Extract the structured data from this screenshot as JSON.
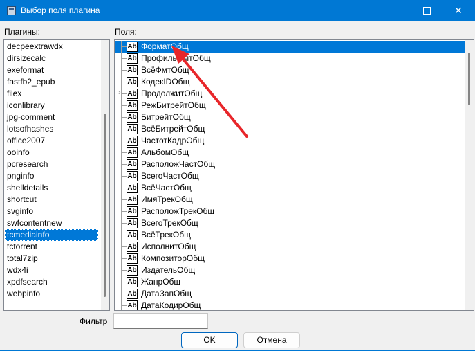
{
  "window": {
    "title": "Выбор поля плагина",
    "accent": "#0078d4",
    "icon": "floppy-disk-icon"
  },
  "labels": {
    "plugins": "Плагины:",
    "fields": "Поля:",
    "filter": "Фильтр"
  },
  "plugins": [
    "decpeextrawdx",
    "dirsizecalc",
    "exeformat",
    "fastfb2_epub",
    "filex",
    "iconlibrary",
    "jpg-comment",
    "lotsofhashes",
    "office2007",
    "ooinfo",
    "pcresearch",
    "pnginfo",
    "shelldetails",
    "shortcut",
    "svginfo",
    "swfcontentnew",
    "tcmediainfo",
    "tctorrent",
    "total7zip",
    "wdx4i",
    "xpdfsearch",
    "webpinfo"
  ],
  "selected_plugin": "tcmediainfo",
  "fields": [
    "ФорматОбщ",
    "ПрофильФмтОбщ",
    "ВсёФмтОбщ",
    "КодекIDОбщ",
    "ПродолжитОбщ",
    "РежБитрейтОбщ",
    "БитрейтОбщ",
    "ВсёБитрейтОбщ",
    "ЧастотКадрОбщ",
    "АльбомОбщ",
    "РасположЧастОбщ",
    "ВсегоЧастОбщ",
    "ВсёЧастОбщ",
    "ИмяТрекОбщ",
    "РасположТрекОбщ",
    "ВсегоТрекОбщ",
    "ВсёТрекОбщ",
    "ИсполнитОбщ",
    "КомпозиторОбщ",
    "ИздательОбщ",
    "ЖанрОбщ",
    "ДатаЗапОбщ",
    "ДатаКодирОбщ"
  ],
  "selected_field": "ФорматОбщ",
  "field_icon": "Ab",
  "filter_value": "",
  "buttons": {
    "ok": "OK",
    "cancel": "Отмена"
  },
  "annotation": {
    "arrow_color": "#e8262a"
  }
}
